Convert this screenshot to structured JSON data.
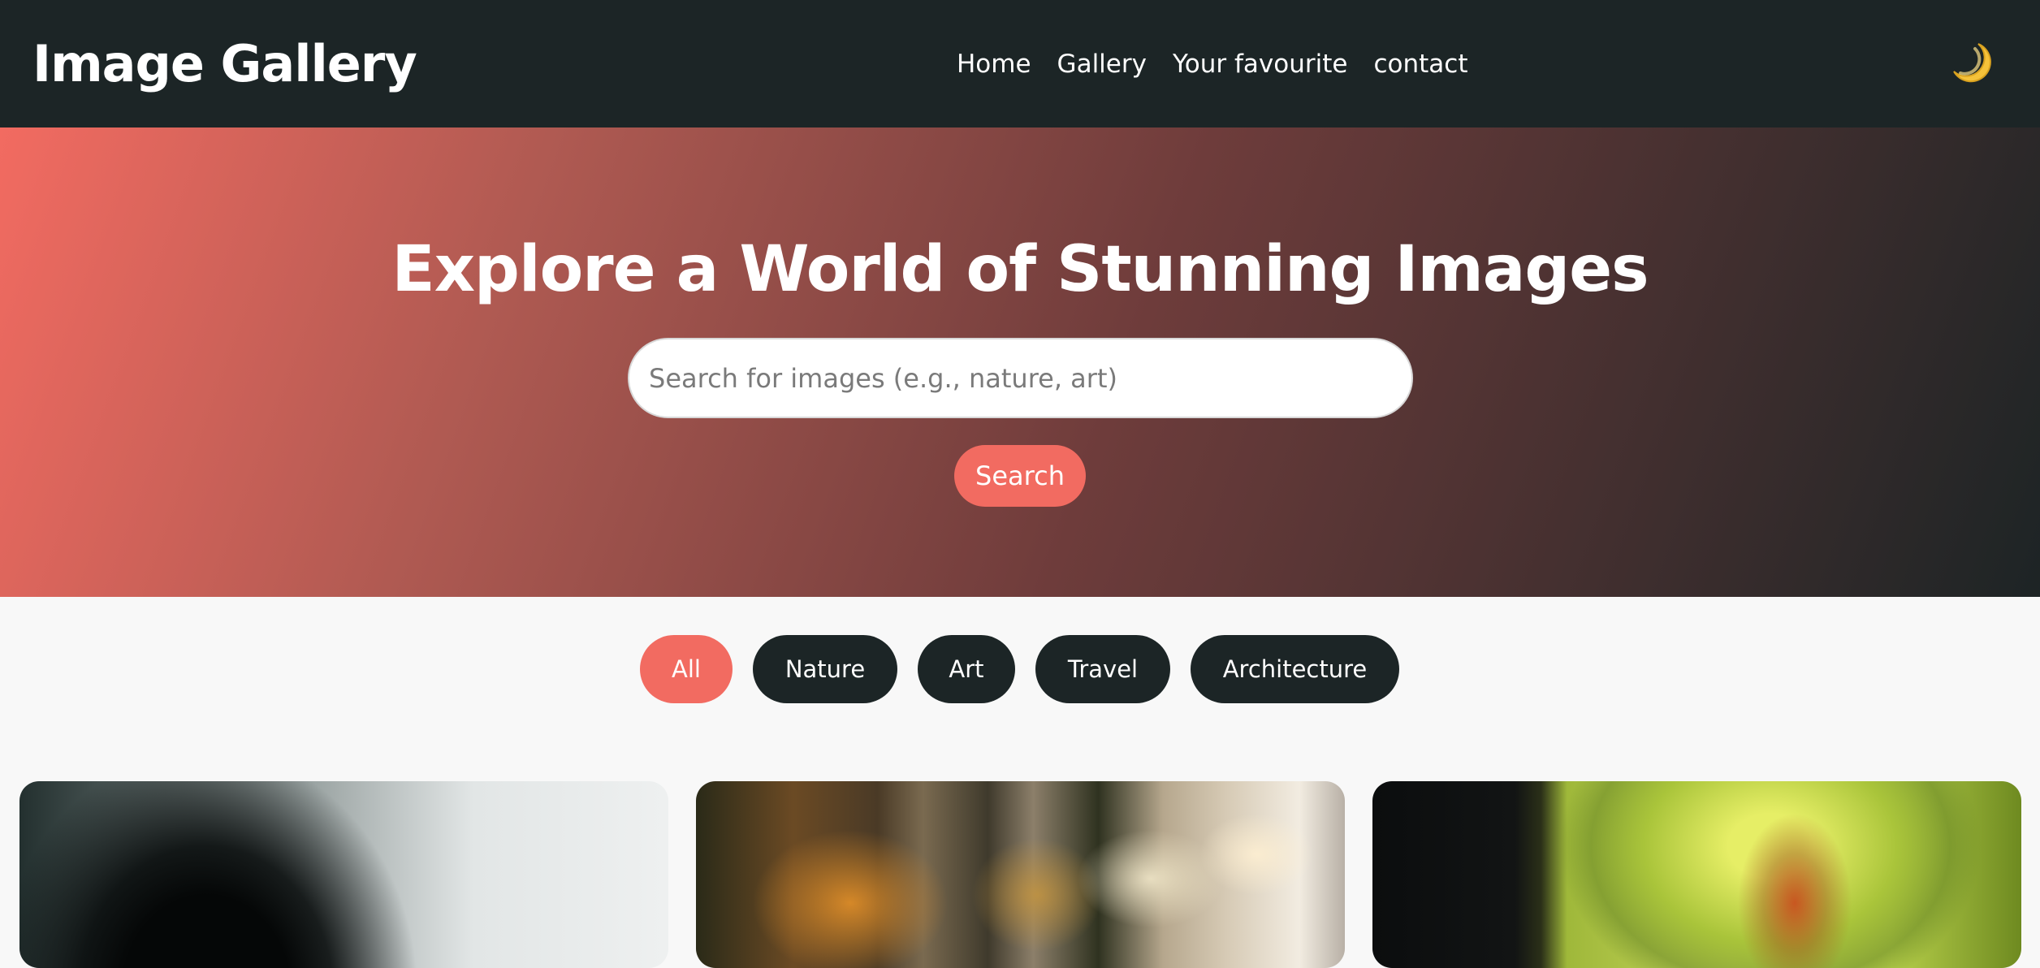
{
  "header": {
    "logo": "Image Gallery",
    "nav": [
      "Home",
      "Gallery",
      "Your favourite",
      "contact"
    ],
    "theme_toggle_icon": "🌙",
    "theme_toggle_icon_name": "moon-icon"
  },
  "hero": {
    "title": "Explore a World of Stunning Images",
    "search_placeholder": "Search for images (e.g., nature, art)",
    "search_value": "",
    "search_button": "Search"
  },
  "filters": {
    "items": [
      "All",
      "Nature",
      "Art",
      "Travel",
      "Architecture"
    ],
    "active": "All"
  },
  "colors": {
    "navbar_bg": "#1c2526",
    "accent": "#f26b61",
    "page_bg": "#f8f8f8"
  }
}
